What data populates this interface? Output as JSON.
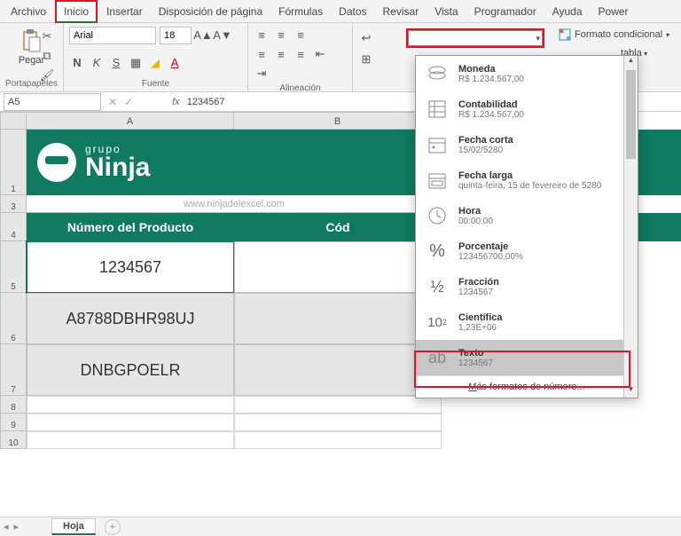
{
  "menu": {
    "items": [
      "Archivo",
      "Inicio",
      "Insertar",
      "Disposición de página",
      "Fórmulas",
      "Datos",
      "Revisar",
      "Vista",
      "Programador",
      "Ayuda",
      "Power"
    ]
  },
  "clipboard": {
    "paste": "Pegar",
    "group": "Portapapeles"
  },
  "font": {
    "family": "Arial",
    "size": "18",
    "bold": "N",
    "italic": "K",
    "underline": "S",
    "group": "Fuente"
  },
  "alignment": {
    "group": "Alineación"
  },
  "numfmt": {
    "value": ""
  },
  "condfmt": "Formato condicional",
  "tblfmt": "tabla",
  "namebox": "A5",
  "fx": "fx",
  "fxval": "1234567",
  "columns": {
    "A": "A",
    "B": "B"
  },
  "logo": {
    "top": "grupo",
    "main": "Ninja"
  },
  "watermark": "www.ninjadelexcel.com",
  "headers": {
    "A": "Número del Producto",
    "B": "Cód"
  },
  "cells": {
    "A5": "1234567",
    "A6": "A8788DBHR98UJ",
    "A7": "DNBGPOELR",
    "B5": "",
    "B6": "",
    "B7": ""
  },
  "dropdown": {
    "items": [
      {
        "icon": "coin-icon",
        "name": "Moneda",
        "sample": "R$ 1.234.567,00"
      },
      {
        "icon": "ledger-icon",
        "name": "Contabilidad",
        "sample": "R$ 1.234.567,00"
      },
      {
        "icon": "calendar-icon",
        "name": "Fecha corta",
        "sample": "15/02/5280"
      },
      {
        "icon": "calendar-range-icon",
        "name": "Fecha larga",
        "sample": "quinta-feira, 15 de fevereiro de 5280"
      },
      {
        "icon": "clock-icon",
        "name": "Hora",
        "sample": "00:00:00"
      },
      {
        "icon": "percent-icon",
        "name": "Porcentaje",
        "sample": "123456700,00%"
      },
      {
        "icon": "fraction-icon",
        "name": "Fracción",
        "sample": "1234567"
      },
      {
        "icon": "scientific-icon",
        "name": "Científica",
        "sample": "1,23E+06"
      },
      {
        "icon": "text-icon",
        "name": "Texto",
        "sample": "1234567"
      }
    ],
    "footer": "Más formatos de número..."
  },
  "sheetTab": "Hoja",
  "rowNums": [
    "1",
    "3",
    "4",
    "5",
    "6",
    "7",
    "8",
    "9",
    "10"
  ]
}
